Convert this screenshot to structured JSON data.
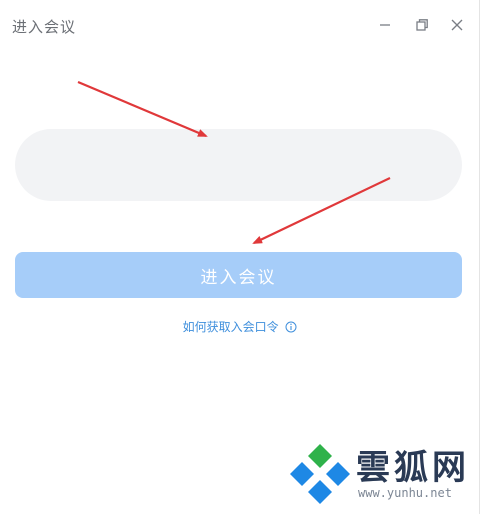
{
  "window": {
    "title": "进入会议",
    "controls": {
      "minimize_icon": "minimize-icon",
      "restore_icon": "restore-icon",
      "close_icon": "close-icon"
    }
  },
  "form": {
    "code_input": {
      "placeholder": "",
      "value": ""
    },
    "join_button_label": "进入会议",
    "help_link_label": "如何获取入会口令",
    "help_icon": "info-icon"
  },
  "watermark": {
    "brand": "雲狐网",
    "url": "www.yunhu.net"
  },
  "colors": {
    "accent_disabled": "#a6cdf9",
    "link": "#3f8fdc",
    "input_bg": "#f2f3f5",
    "annotation_arrow": "#e0383a"
  }
}
